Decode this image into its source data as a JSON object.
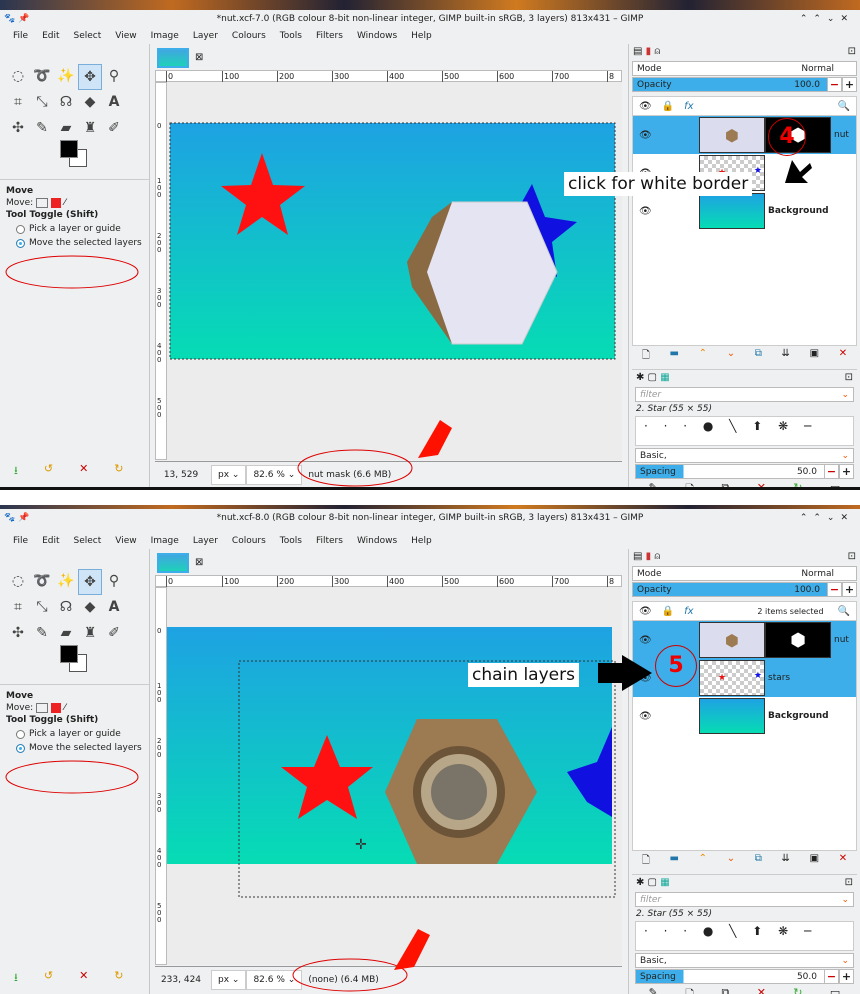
{
  "windows": [
    {
      "title": "*nut.xcf-7.0 (RGB colour 8-bit non-linear integer, GIMP built-in sRGB, 3 layers) 813x431 – GIMP",
      "menu": [
        "File",
        "Edit",
        "Select",
        "View",
        "Image",
        "Layer",
        "Colours",
        "Tools",
        "Filters",
        "Windows",
        "Help"
      ],
      "tool_options": {
        "title": "Move",
        "move_label": "Move:",
        "toggle_label": "Tool Toggle  (Shift)",
        "option1": "Pick a layer or guide",
        "option2": "Move the selected layers",
        "selected": "option2"
      },
      "ruler_h": [
        "0",
        "100",
        "200",
        "300",
        "400",
        "500",
        "600",
        "700",
        "8"
      ],
      "ruler_v": [
        "0",
        "100",
        "200",
        "300",
        "400",
        "500"
      ],
      "status": {
        "coords": "13, 529",
        "unit": "px",
        "zoom": "82.6 %",
        "message": "nut mask (6.6 MB)"
      },
      "dock": {
        "mode_label": "Mode",
        "mode_value": "Normal",
        "opacity_label": "Opacity",
        "opacity_value": "100.0",
        "selected_info": "",
        "layers": [
          {
            "name": "nut",
            "selected": true
          },
          {
            "name": "",
            "selected": false
          },
          {
            "name": "Background",
            "selected": false
          }
        ],
        "brush_filter_placeholder": "filter",
        "brush_name": "2. Star (55 × 55)",
        "preset": "Basic,",
        "spacing_label": "Spacing",
        "spacing_value": "50.0"
      },
      "annotations": {
        "callout": "click for white border",
        "step": "4"
      }
    },
    {
      "title": "*nut.xcf-8.0 (RGB colour 8-bit non-linear integer, GIMP built-in sRGB, 3 layers) 813x431 – GIMP",
      "menu": [
        "File",
        "Edit",
        "Select",
        "View",
        "Image",
        "Layer",
        "Colours",
        "Tools",
        "Filters",
        "Windows",
        "Help"
      ],
      "tool_options": {
        "title": "Move",
        "move_label": "Move:",
        "toggle_label": "Tool Toggle  (Shift)",
        "option1": "Pick a layer or guide",
        "option2": "Move the selected layers",
        "selected": "option2"
      },
      "ruler_h": [
        "0",
        "100",
        "200",
        "300",
        "400",
        "500",
        "600",
        "700",
        "8"
      ],
      "ruler_v": [
        "0",
        "100",
        "200",
        "300",
        "400",
        "500"
      ],
      "status": {
        "coords": "233, 424",
        "unit": "px",
        "zoom": "82.6 %",
        "message": "(none) (6.4 MB)"
      },
      "dock": {
        "mode_label": "Mode",
        "mode_value": "Normal",
        "opacity_label": "Opacity",
        "opacity_value": "100.0",
        "selected_info": "2 items selected",
        "layers": [
          {
            "name": "nut",
            "selected": true
          },
          {
            "name": "stars",
            "selected": true
          },
          {
            "name": "Background",
            "selected": false
          }
        ],
        "brush_filter_placeholder": "filter",
        "brush_name": "2. Star (55 × 55)",
        "preset": "Basic,",
        "spacing_label": "Spacing",
        "spacing_value": "50.0"
      },
      "annotations": {
        "callout": "chain layers",
        "step": "5"
      }
    }
  ],
  "colors": {
    "accent": "#3daee9",
    "annotation_red": "#e00000"
  }
}
